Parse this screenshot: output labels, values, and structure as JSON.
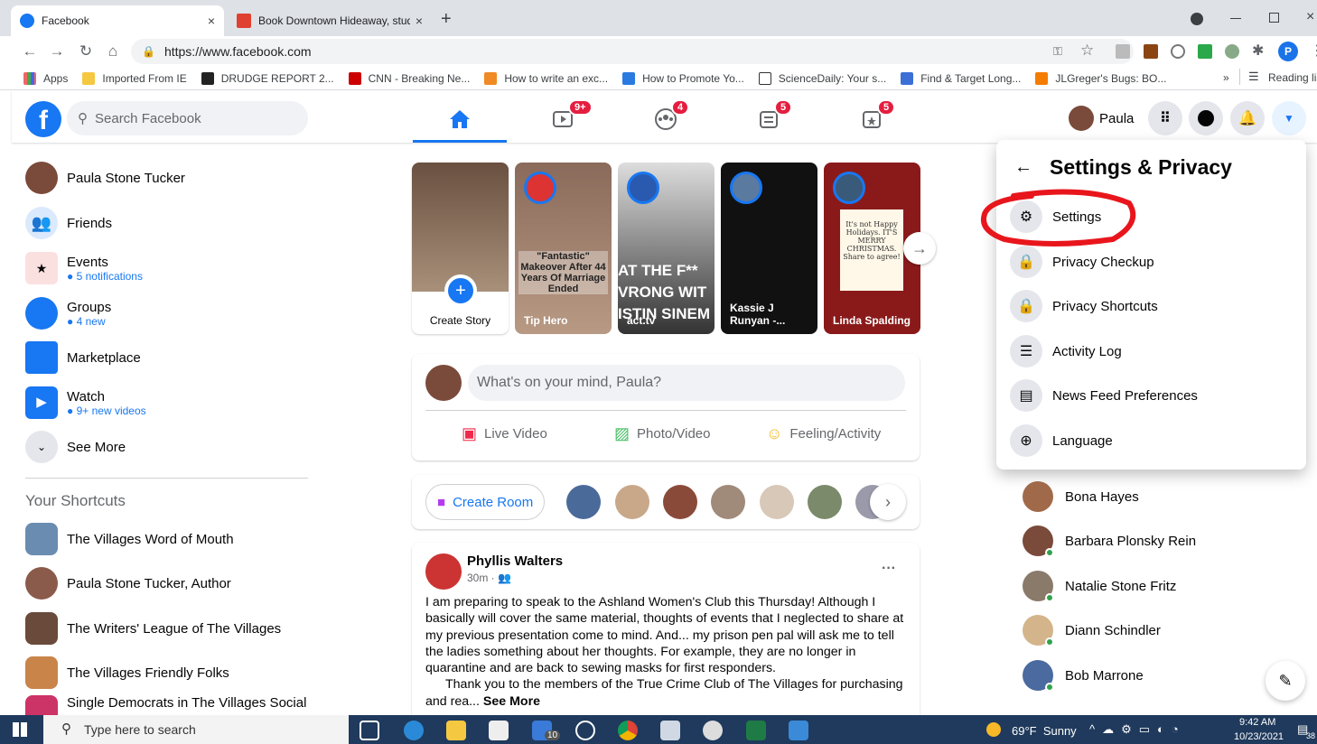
{
  "browser": {
    "tabs": [
      {
        "label": "Facebook",
        "close": "×"
      },
      {
        "label": "Book Downtown Hideaway, stud",
        "close": "×"
      }
    ],
    "new_tab": "+",
    "url": "https://www.facebook.com",
    "bookmarks": [
      "Apps",
      "Imported From IE",
      "DRUDGE REPORT 2...",
      "CNN - Breaking Ne...",
      "How to write an exc...",
      "How to Promote Yo...",
      "ScienceDaily: Your s...",
      "Find & Target Long...",
      "JLGreger's Bugs: BO..."
    ],
    "overflow": "»",
    "reading_list": "Reading list",
    "profile_initial": "P"
  },
  "fb": {
    "logo": "f",
    "search_placeholder": "Search Facebook",
    "nav_badges": {
      "watch": "9+",
      "groups": "4",
      "pages": "5",
      "events": "5"
    },
    "user_name": "Paula"
  },
  "left": {
    "items": [
      {
        "label": "Paula Stone Tucker",
        "sub": ""
      },
      {
        "label": "Friends",
        "sub": ""
      },
      {
        "label": "Events",
        "sub": "5 notifications"
      },
      {
        "label": "Groups",
        "sub": "4 new"
      },
      {
        "label": "Marketplace",
        "sub": ""
      },
      {
        "label": "Watch",
        "sub": "9+ new videos"
      },
      {
        "label": "See More",
        "sub": ""
      }
    ],
    "shortcuts_title": "Your Shortcuts",
    "shortcuts": [
      "The Villages Word of Mouth",
      "Paula Stone Tucker, Author",
      "The Writers' League of The Villages",
      "The Villages Friendly Folks",
      "Single Democrats in The Villages Social"
    ]
  },
  "stories": [
    {
      "name": "Create Story"
    },
    {
      "name": "Tip Hero",
      "caption": "\"Fantastic\" Makeover After 44 Years Of Marriage Ended"
    },
    {
      "name": "act.tv",
      "caption": "AT THE F** VRONG WIT ISTIN SINEM"
    },
    {
      "name": "Kassie J Runyan -..."
    },
    {
      "name": "Linda Spalding",
      "caption": "It's not Happy Holidays. IT'S MERRY CHRISTMAS. Share to agree!"
    }
  ],
  "composer": {
    "placeholder": "What's on your mind, Paula?",
    "actions": [
      "Live Video",
      "Photo/Video",
      "Feeling/Activity"
    ]
  },
  "rooms": {
    "create": "Create Room"
  },
  "post": {
    "author": "Phyllis Walters",
    "meta": "30m ·",
    "menu": "···",
    "text": "I am preparing to speak to the Ashland Women's Club this Thursday! Although I basically will cover the same material, thoughts of events that I neglected to share at my previous presentation come to mind.  And... my prison pen pal will ask me to tell the ladies something about her thoughts. For example, they are no longer in quarantine and are back to sewing masks for first responders.",
    "text2": "Thank you to the members of the True Crime Club of The Villages for purchasing and rea...",
    "see_more": "See More"
  },
  "settings_menu": {
    "title": "Settings & Privacy",
    "items": [
      "Settings",
      "Privacy Checkup",
      "Privacy Shortcuts",
      "Activity Log",
      "News Feed Preferences",
      "Language"
    ]
  },
  "contacts": [
    "Bona Hayes",
    "Barbara Plonsky Rein",
    "Natalie Stone Fritz",
    "Diann Schindler",
    "Bob Marrone"
  ],
  "taskbar": {
    "search": "Type here to search",
    "weather": "69°F  Sunny",
    "time": "9:42 AM",
    "date": "10/23/2021",
    "mail_badge": "10",
    "notif": "38"
  }
}
